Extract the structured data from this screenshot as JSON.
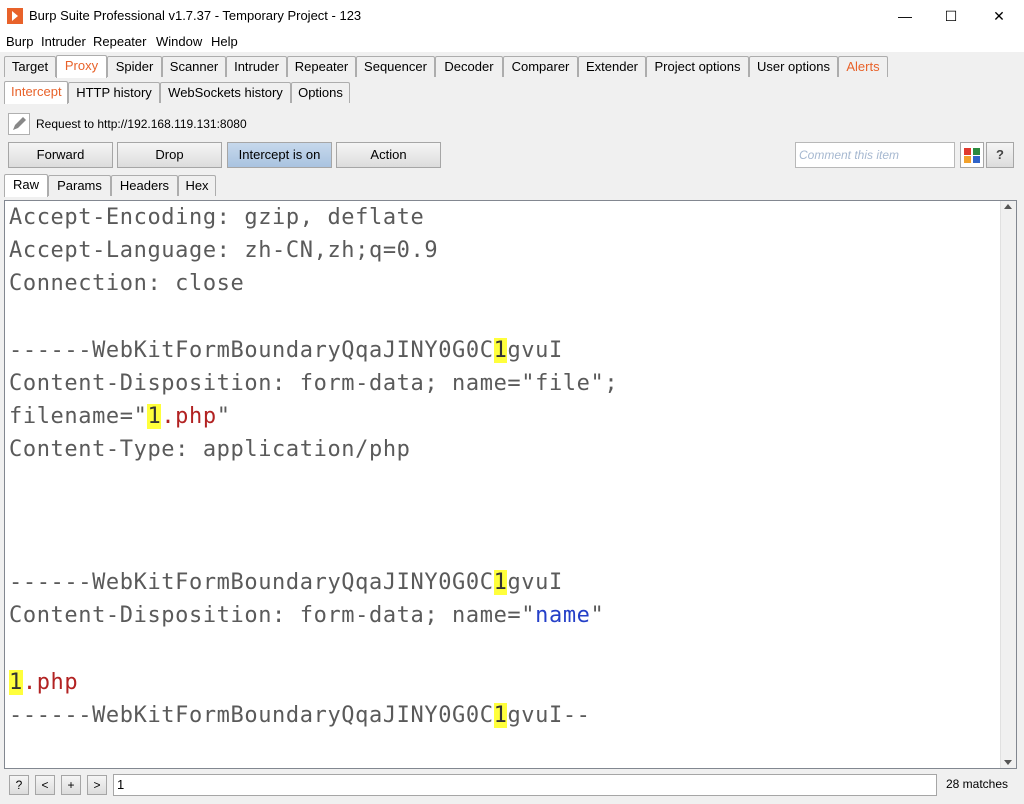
{
  "window": {
    "title": "Burp Suite Professional v1.7.37 - Temporary Project - 123",
    "minimize": "—",
    "maximize": "☐",
    "close": "✕"
  },
  "menu": [
    "Burp",
    "Intruder",
    "Repeater",
    "Window",
    "Help"
  ],
  "main_tabs": [
    "Target",
    "Proxy",
    "Spider",
    "Scanner",
    "Intruder",
    "Repeater",
    "Sequencer",
    "Decoder",
    "Comparer",
    "Extender",
    "Project options",
    "User options",
    "Alerts"
  ],
  "proxy_tabs": [
    "Intercept",
    "HTTP history",
    "WebSockets history",
    "Options"
  ],
  "request_label": "Request to http://192.168.119.131:8080",
  "buttons": {
    "forward": "Forward",
    "drop": "Drop",
    "intercept": "Intercept is on",
    "action": "Action"
  },
  "comment_placeholder": "Comment this item",
  "help_label": "?",
  "view_tabs": [
    "Raw",
    "Params",
    "Headers",
    "Hex"
  ],
  "code": {
    "l1": "Accept-Encoding: gzip, deflate",
    "l2": "Accept-Language: zh-CN,zh;q=0.9",
    "l3": "Connection: close",
    "b_pre": "------WebKitFormBoundaryQqaJINY0G0C",
    "b_hl": "1",
    "b_post": "gvuI",
    "cd_file": "Content-Disposition: form-data; name=\"file\";",
    "fn_pre": "filename=\"",
    "fn_hl": "1",
    "fn_ext": ".php",
    "fn_post": "\"",
    "ct": "Content-Type: application/php",
    "cd_name_pre": "Content-Disposition: form-data; name=\"",
    "cd_name_val": "name",
    "cd_name_post": "\"",
    "val_hl": "1",
    "val_ext": ".php",
    "end_post": "gvuI--"
  },
  "search": {
    "help": "?",
    "prev": "<",
    "add": "+",
    "next": ">",
    "value": "1",
    "matches": "28 matches"
  }
}
